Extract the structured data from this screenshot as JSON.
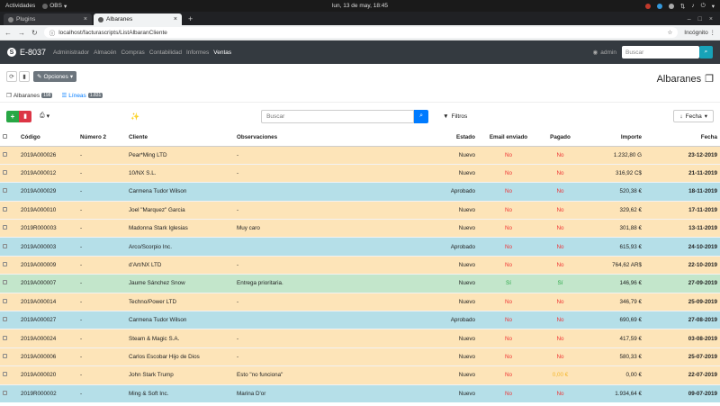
{
  "system": {
    "activities": "Actividades",
    "app_name": "OBS",
    "clock": "lun, 13 de may, 18:45"
  },
  "browser": {
    "tabs": [
      {
        "label": "Plugins"
      },
      {
        "label": "Albaranes"
      }
    ],
    "new_tab": "+",
    "url": "localhost/facturascripts/ListAlbaranCliente",
    "incognito": "Incógnito"
  },
  "app": {
    "brand": "E-8037",
    "menu": [
      "Administrador",
      "Almacén",
      "Compras",
      "Contabilidad",
      "Informes",
      "Ventas"
    ],
    "user": "admin",
    "search_placeholder": "Buscar"
  },
  "toolbar": {
    "options_label": "Opciones",
    "page_title": "Albaranes"
  },
  "view_tabs": [
    {
      "label": "Albaranes",
      "badge": "198"
    },
    {
      "label": "Líneas",
      "badge": "1.831"
    }
  ],
  "list": {
    "search_placeholder": "Buscar",
    "filters_label": "Filtros",
    "sort_label": "Fecha"
  },
  "table": {
    "headers": [
      "Código",
      "Número 2",
      "Cliente",
      "Observaciones",
      "Estado",
      "Email enviado",
      "Pagado",
      "Importe",
      "Fecha"
    ],
    "rows": [
      {
        "codigo": "2019A000026",
        "numero2": "-",
        "cliente": "Pear*Ming LTD",
        "observaciones": "-",
        "estado": "Nuevo",
        "email": "No",
        "pagado": "No",
        "importe": "1.232,80 G",
        "fecha": "23-12-2019",
        "status": "warn"
      },
      {
        "codigo": "2019A000012",
        "numero2": "-",
        "cliente": "10/NX S.L.",
        "observaciones": "-",
        "estado": "Nuevo",
        "email": "No",
        "pagado": "No",
        "importe": "316,92 C$",
        "fecha": "21-11-2019",
        "status": "warn"
      },
      {
        "codigo": "2019A000029",
        "numero2": "-",
        "cliente": "Carmena Tudor Wilson",
        "observaciones": "",
        "estado": "Aprobado",
        "email": "No",
        "pagado": "No",
        "importe": "520,38 €",
        "fecha": "18-11-2019",
        "status": "info"
      },
      {
        "codigo": "2019A000010",
        "numero2": "-",
        "cliente": "Joel \"Marquez\" Garcia",
        "observaciones": "-",
        "estado": "Nuevo",
        "email": "No",
        "pagado": "No",
        "importe": "329,62 €",
        "fecha": "17-11-2019",
        "status": "warn"
      },
      {
        "codigo": "2019R000003",
        "numero2": "-",
        "cliente": "Madonna Stark Iglesias",
        "observaciones": "Muy caro",
        "estado": "Nuevo",
        "email": "No",
        "pagado": "No",
        "importe": "301,88 €",
        "fecha": "13-11-2019",
        "status": "warn"
      },
      {
        "codigo": "2019A000003",
        "numero2": "-",
        "cliente": "Arco/Scorpio Inc.",
        "observaciones": "",
        "estado": "Aprobado",
        "email": "No",
        "pagado": "No",
        "importe": "615,93 €",
        "fecha": "24-10-2019",
        "status": "info"
      },
      {
        "codigo": "2019A000009",
        "numero2": "-",
        "cliente": "d'Art/NX LTD",
        "observaciones": "-",
        "estado": "Nuevo",
        "email": "No",
        "pagado": "No",
        "importe": "764,62 AR$",
        "fecha": "22-10-2019",
        "status": "warn"
      },
      {
        "codigo": "2019A000007",
        "numero2": "-",
        "cliente": "Jaume Sánchez Snow",
        "observaciones": "Entrega prioritaria.",
        "estado": "Nuevo",
        "email": "Sí",
        "pagado": "Sí",
        "importe": "146,96 €",
        "fecha": "27-09-2019",
        "status": "ok"
      },
      {
        "codigo": "2019A000014",
        "numero2": "-",
        "cliente": "Techno/Power LTD",
        "observaciones": "-",
        "estado": "Nuevo",
        "email": "No",
        "pagado": "No",
        "importe": "346,79 €",
        "fecha": "25-09-2019",
        "status": "warn"
      },
      {
        "codigo": "2019A000027",
        "numero2": "-",
        "cliente": "Carmena Tudor Wilson",
        "observaciones": "",
        "estado": "Aprobado",
        "email": "No",
        "pagado": "No",
        "importe": "690,69 €",
        "fecha": "27-08-2019",
        "status": "info"
      },
      {
        "codigo": "2019A000024",
        "numero2": "-",
        "cliente": "Steam & Magic S.A.",
        "observaciones": "-",
        "estado": "Nuevo",
        "email": "No",
        "pagado": "No",
        "importe": "417,59 €",
        "fecha": "03-08-2019",
        "status": "warn"
      },
      {
        "codigo": "2019A000006",
        "numero2": "-",
        "cliente": "Carlos Escobar Hijo de Dios",
        "observaciones": "-",
        "estado": "Nuevo",
        "email": "No",
        "pagado": "No",
        "importe": "580,33 €",
        "fecha": "25-07-2019",
        "status": "warn"
      },
      {
        "codigo": "2019A000020",
        "numero2": "-",
        "cliente": "John Stark Trump",
        "observaciones": "Esto \"no funciona\"",
        "estado": "Nuevo",
        "email": "No",
        "pagado": "0,00 €",
        "importe": "0,00 €",
        "fecha": "22-07-2019",
        "status": "warn",
        "pending": true
      },
      {
        "codigo": "2019R000002",
        "numero2": "-",
        "cliente": "Ming & Soft Inc.",
        "observaciones": "Marina D'or",
        "estado": "Nuevo",
        "email": "No",
        "pagado": "No",
        "importe": "1.934,64 €",
        "fecha": "09-07-2019",
        "status": "info"
      }
    ]
  },
  "colors": {
    "warning_row": "#fde4b8",
    "info_row": "#b5dfe8",
    "success_row": "#c3e6cb",
    "accent": "#007bff"
  }
}
